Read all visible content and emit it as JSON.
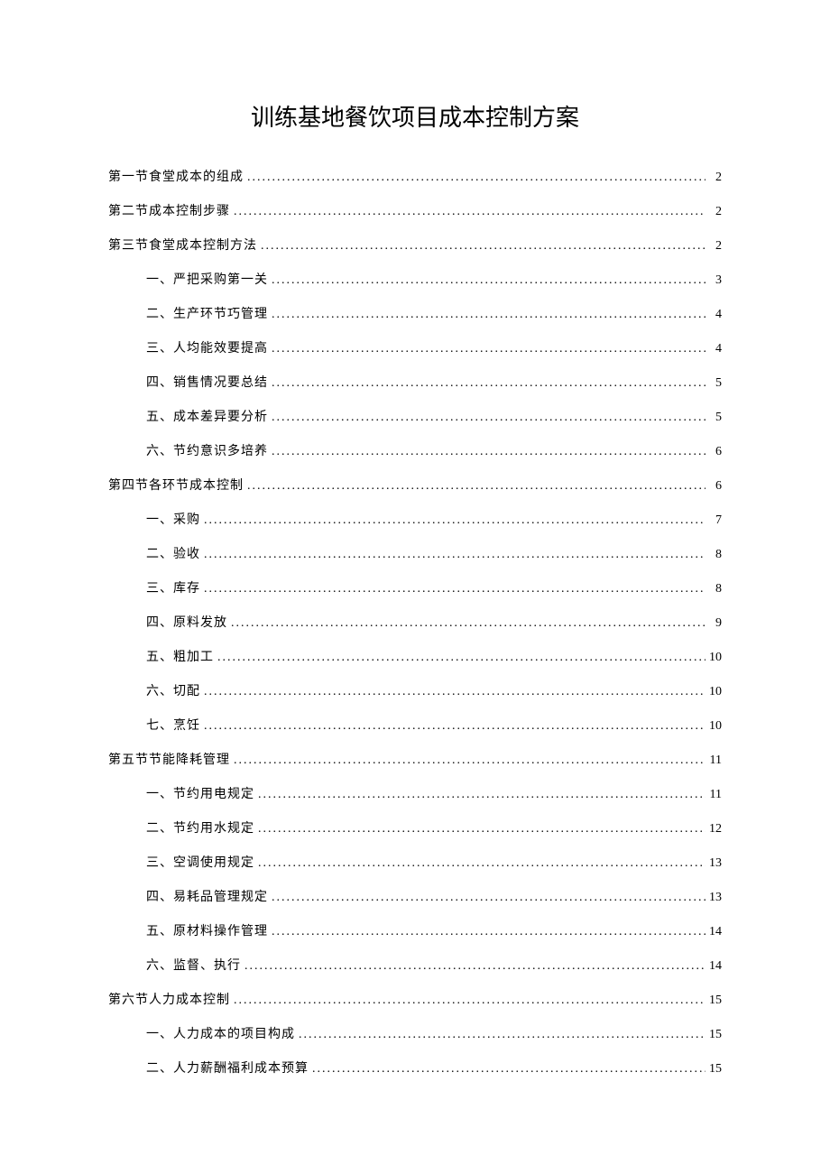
{
  "title": "训练基地餐饮项目成本控制方案",
  "toc": [
    {
      "level": 1,
      "label": "第一节食堂成本的组成",
      "page": "2"
    },
    {
      "level": 1,
      "label": "第二节成本控制步骤",
      "page": "2"
    },
    {
      "level": 1,
      "label": "第三节食堂成本控制方法",
      "page": "2"
    },
    {
      "level": 2,
      "label": "一、严把采购第一关",
      "page": "3"
    },
    {
      "level": 2,
      "label": "二、生产环节巧管理",
      "page": "4"
    },
    {
      "level": 2,
      "label": "三、人均能效要提高",
      "page": "4"
    },
    {
      "level": 2,
      "label": "四、销售情况要总结",
      "page": "5"
    },
    {
      "level": 2,
      "label": "五、成本差异要分析",
      "page": "5"
    },
    {
      "level": 2,
      "label": "六、节约意识多培养",
      "page": "6"
    },
    {
      "level": 1,
      "label": "第四节各环节成本控制",
      "page": "6"
    },
    {
      "level": 2,
      "label": "一、采购",
      "page": "7"
    },
    {
      "level": 2,
      "label": "二、验收",
      "page": "8"
    },
    {
      "level": 2,
      "label": "三、库存",
      "page": "8"
    },
    {
      "level": 2,
      "label": "四、原料发放",
      "page": "9"
    },
    {
      "level": 2,
      "label": "五、粗加工",
      "page": "10"
    },
    {
      "level": 2,
      "label": "六、切配",
      "page": "10"
    },
    {
      "level": 2,
      "label": "七、烹饪",
      "page": "10"
    },
    {
      "level": 1,
      "label": "第五节节能降耗管理",
      "page": "11"
    },
    {
      "level": 2,
      "label": "一、节约用电规定",
      "page": "11"
    },
    {
      "level": 2,
      "label": "二、节约用水规定",
      "page": "12"
    },
    {
      "level": 2,
      "label": "三、空调使用规定",
      "page": "13"
    },
    {
      "level": 2,
      "label": "四、易耗品管理规定",
      "page": "13"
    },
    {
      "level": 2,
      "label": "五、原材料操作管理",
      "page": "14"
    },
    {
      "level": 2,
      "label": "六、监督、执行",
      "page": "14"
    },
    {
      "level": 1,
      "label": "第六节人力成本控制",
      "page": "15"
    },
    {
      "level": 2,
      "label": "一、人力成本的项目构成",
      "page": "15"
    },
    {
      "level": 2,
      "label": "二、人力薪酬福利成本预算",
      "page": "15"
    }
  ]
}
